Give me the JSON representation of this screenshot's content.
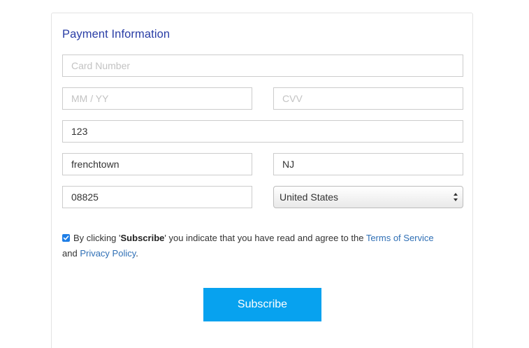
{
  "payment": {
    "title": "Payment Information",
    "card_number": {
      "value": "",
      "placeholder": "Card Number"
    },
    "expiry": {
      "value": "",
      "placeholder": "MM / YY"
    },
    "cvv": {
      "value": "",
      "placeholder": "CVV"
    },
    "address": {
      "value": "123",
      "placeholder": ""
    },
    "city": {
      "value": "frenchtown",
      "placeholder": ""
    },
    "state": {
      "value": "NJ",
      "placeholder": ""
    },
    "zip": {
      "value": "08825",
      "placeholder": ""
    },
    "country": {
      "selected": "United States"
    }
  },
  "agreement": {
    "checked": true,
    "prefix": "By clicking '",
    "bold": "Subscribe",
    "middle": "' you indicate that you have read and agree to the ",
    "terms_link": "Terms of Service",
    "and": " and ",
    "privacy_link": "Privacy Policy",
    "suffix": "."
  },
  "buttons": {
    "subscribe_label": "Subscribe"
  },
  "colors": {
    "title": "#2a3ea6",
    "link": "#2f6fb5",
    "button": "#07a2ef",
    "checkbox": "#1e7ee6"
  }
}
